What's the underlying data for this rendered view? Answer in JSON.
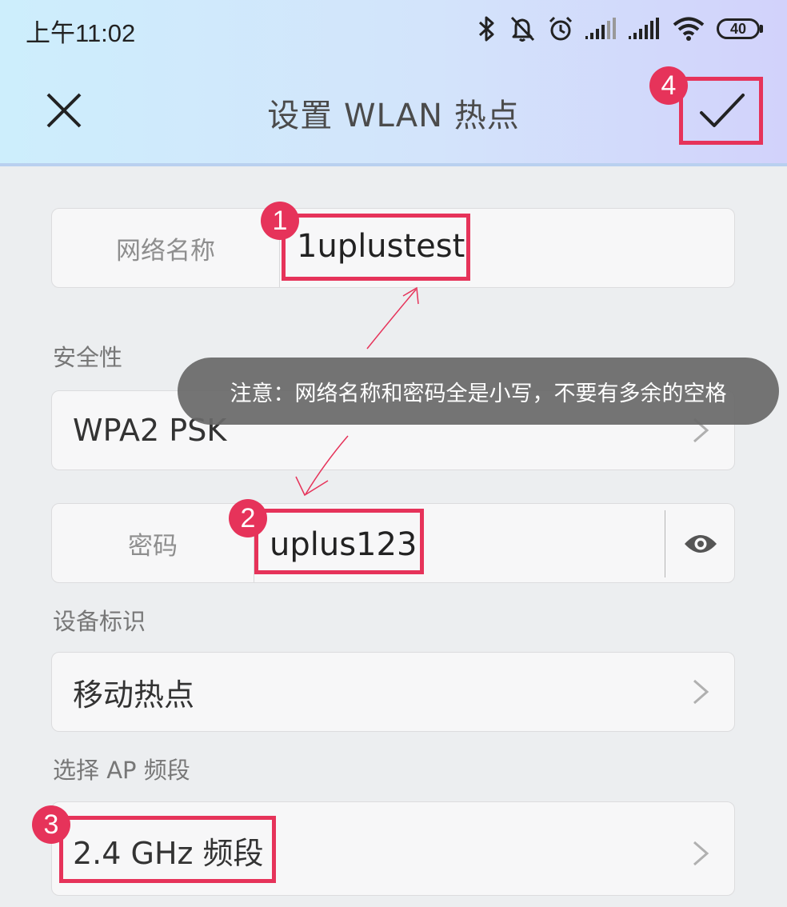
{
  "status_bar": {
    "time": "上午11:02",
    "battery": "40",
    "icons": [
      "bluetooth-icon",
      "mute-icon",
      "alarm-icon",
      "signal-icon",
      "signal-icon",
      "wifi-icon",
      "battery-icon"
    ]
  },
  "header": {
    "title": "设置 WLAN 热点",
    "close_icon": "close-icon",
    "confirm_icon": "check-icon"
  },
  "form": {
    "network_name": {
      "label": "网络名称",
      "value": "1uplustest"
    },
    "security": {
      "section_label": "安全性",
      "value": "WPA2 PSK"
    },
    "password": {
      "label": "密码",
      "value": "uplus123"
    },
    "device_id": {
      "section_label": "设备标识",
      "value": "移动热点"
    },
    "band": {
      "section_label": "选择 AP 频段",
      "value": "2.4 GHz 频段"
    }
  },
  "annotations": {
    "badges": [
      "1",
      "2",
      "3",
      "4"
    ],
    "tooltip": "注意：网络名称和密码全是小写，不要有多余的空格",
    "accent_color": "#e6335a"
  }
}
